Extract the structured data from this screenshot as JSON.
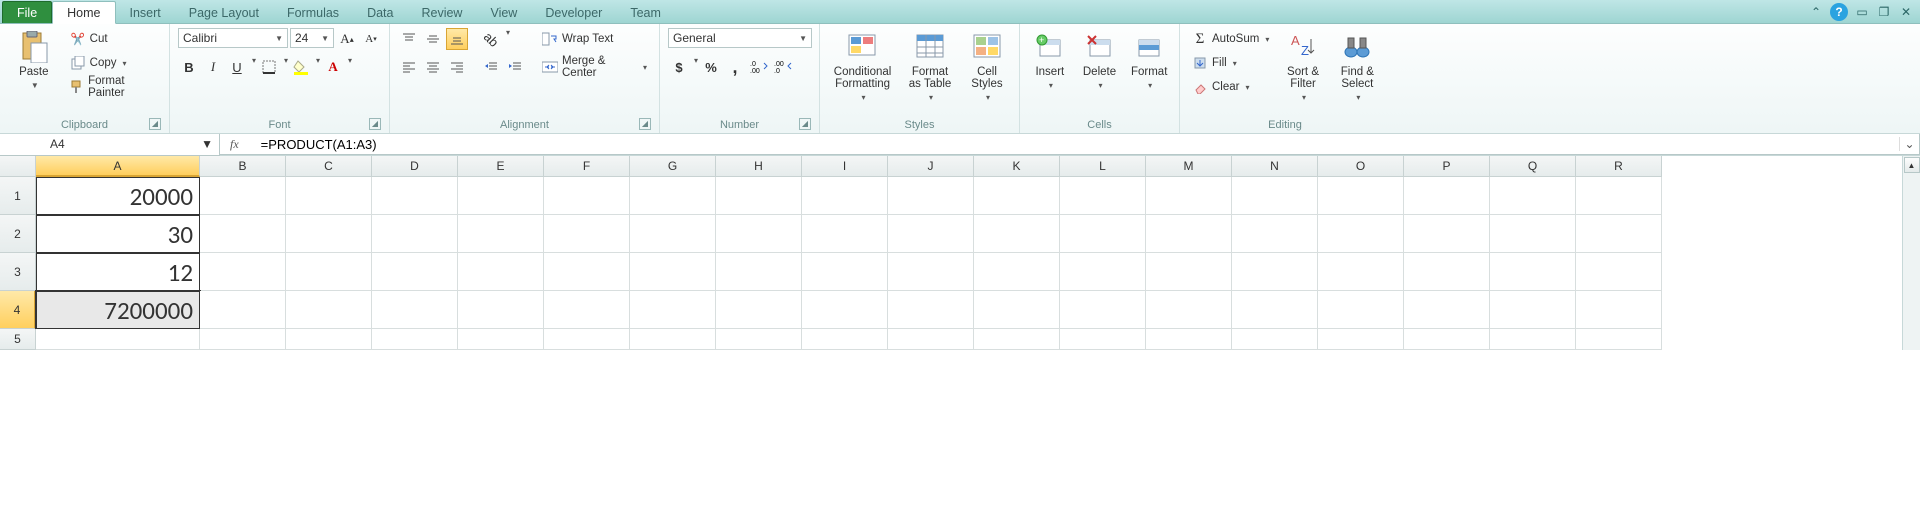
{
  "tabs": {
    "file": "File",
    "items": [
      "Home",
      "Insert",
      "Page Layout",
      "Formulas",
      "Data",
      "Review",
      "View",
      "Developer",
      "Team"
    ],
    "active": "Home"
  },
  "clipboard": {
    "paste": "Paste",
    "cut": "Cut",
    "copy": "Copy",
    "format_painter": "Format Painter",
    "group": "Clipboard"
  },
  "font": {
    "name": "Calibri",
    "size": "24",
    "group": "Font",
    "bold": "B",
    "italic": "I",
    "underline": "U"
  },
  "alignment": {
    "wrap": "Wrap Text",
    "merge": "Merge & Center",
    "group": "Alignment"
  },
  "number": {
    "format": "General",
    "currency": "$",
    "percent": "%",
    "comma": ",",
    "inc": ".00→.0",
    "dec": ".0→.00",
    "group": "Number"
  },
  "styles": {
    "cond": "Conditional Formatting",
    "table": "Format as Table",
    "cell": "Cell Styles",
    "group": "Styles"
  },
  "cells": {
    "insert": "Insert",
    "delete": "Delete",
    "format": "Format",
    "group": "Cells"
  },
  "editing": {
    "autosum": "AutoSum",
    "fill": "Fill",
    "clear": "Clear",
    "sort": "Sort & Filter",
    "find": "Find & Select",
    "group": "Editing"
  },
  "formula_bar": {
    "cell_ref": "A4",
    "formula": "=PRODUCT(A1:A3)",
    "fx": "fx"
  },
  "columns": [
    "A",
    "B",
    "C",
    "D",
    "E",
    "F",
    "G",
    "H",
    "I",
    "J",
    "K",
    "L",
    "M",
    "N",
    "O",
    "P",
    "Q",
    "R"
  ],
  "rows": [
    "1",
    "2",
    "3",
    "4",
    "5"
  ],
  "data": {
    "A1": "20000",
    "A2": "30",
    "A3": "12",
    "A4": "7200000"
  },
  "chart_data": {
    "type": "table",
    "title": "",
    "columns": [
      "A"
    ],
    "rows": [
      {
        "row": 1,
        "A": 20000
      },
      {
        "row": 2,
        "A": 30
      },
      {
        "row": 3,
        "A": 12
      },
      {
        "row": 4,
        "A": 7200000,
        "formula": "=PRODUCT(A1:A3)"
      }
    ]
  },
  "selected_cell": "A4"
}
